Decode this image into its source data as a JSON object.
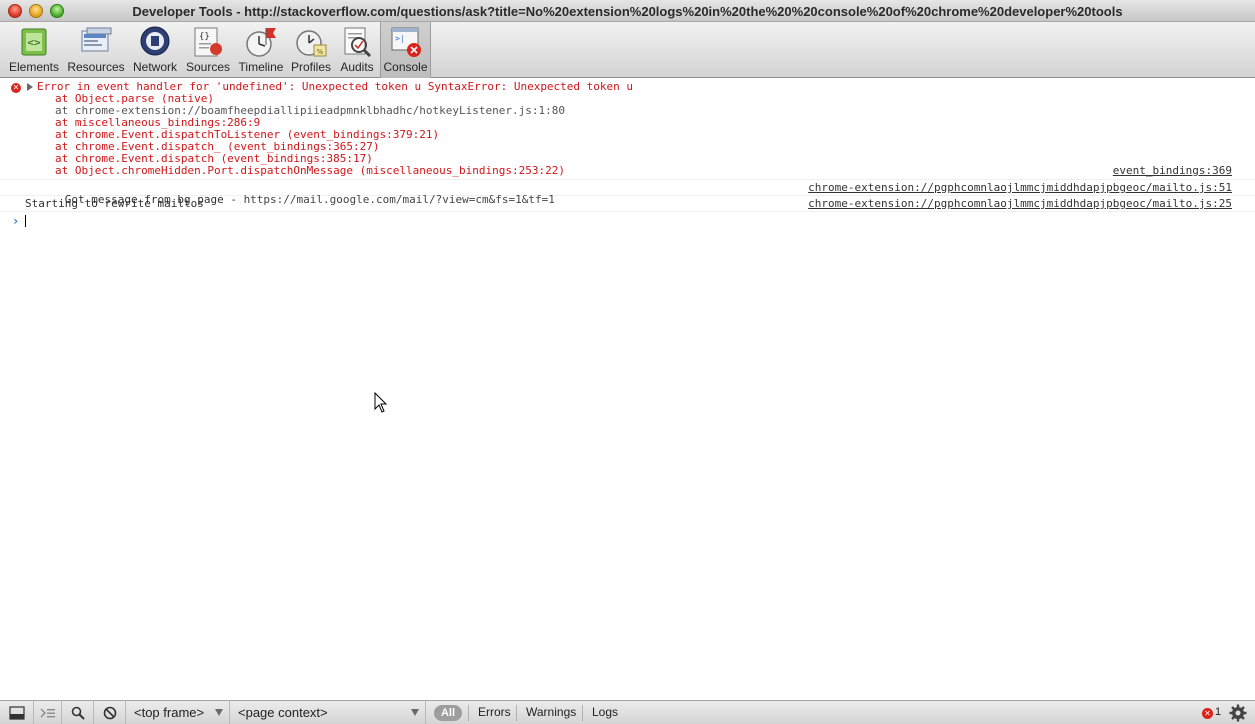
{
  "window": {
    "title": "Developer Tools - http://stackoverflow.com/questions/ask?title=No%20extension%20logs%20in%20the%20%20console%20of%20chrome%20developer%20tools"
  },
  "toolbar": {
    "items": [
      {
        "label": "Elements",
        "icon": "elements-icon"
      },
      {
        "label": "Resources",
        "icon": "resources-icon"
      },
      {
        "label": "Network",
        "icon": "network-icon"
      },
      {
        "label": "Sources",
        "icon": "sources-icon"
      },
      {
        "label": "Timeline",
        "icon": "timeline-icon"
      },
      {
        "label": "Profiles",
        "icon": "profiles-icon"
      },
      {
        "label": "Audits",
        "icon": "audits-icon"
      },
      {
        "label": "Console",
        "icon": "console-icon",
        "selected": true
      }
    ]
  },
  "console": {
    "error": {
      "message": "Error in event handler for 'undefined': Unexpected token u SyntaxError: Unexpected token u",
      "stack": [
        "at Object.parse (native)",
        "at chrome-extension://boamfheepdiallipiieadpmnklbhadhc/hotkeyListener.js:1:80",
        "at miscellaneous_bindings:286:9",
        "at chrome.Event.dispatchToListener (event_bindings:379:21)",
        "at chrome.Event.dispatch_ (event_bindings:365:27)",
        "at chrome.Event.dispatch (event_bindings:385:17)",
        "at Object.chromeHidden.Port.dispatchOnMessage (miscellaneous_bindings:253:22)"
      ],
      "source": "event_bindings:369"
    },
    "logs": [
      {
        "text": "Got message from bg page - ",
        "url": "https://mail.google.com/mail/?view=cm&fs=1&tf=1",
        "source": "chrome-extension://pgphcomnlaojlmmcjmiddhdapjpbgeoc/mailto.js:51"
      },
      {
        "text": "Starting to rewrite mailtos",
        "url": "",
        "source": "chrome-extension://pgphcomnlaojlmmcjmiddhdapjpbgeoc/mailto.js:25"
      }
    ],
    "prompt_symbol": "›"
  },
  "statusbar": {
    "frame_select": "<top frame>",
    "context_select": "<page context>",
    "filter_all": "All",
    "filter_errors": "Errors",
    "filter_warnings": "Warnings",
    "filter_logs": "Logs",
    "error_count": "1"
  },
  "colors": {
    "error_red": "#d0161a",
    "prompt_blue": "#2f6fd6"
  }
}
